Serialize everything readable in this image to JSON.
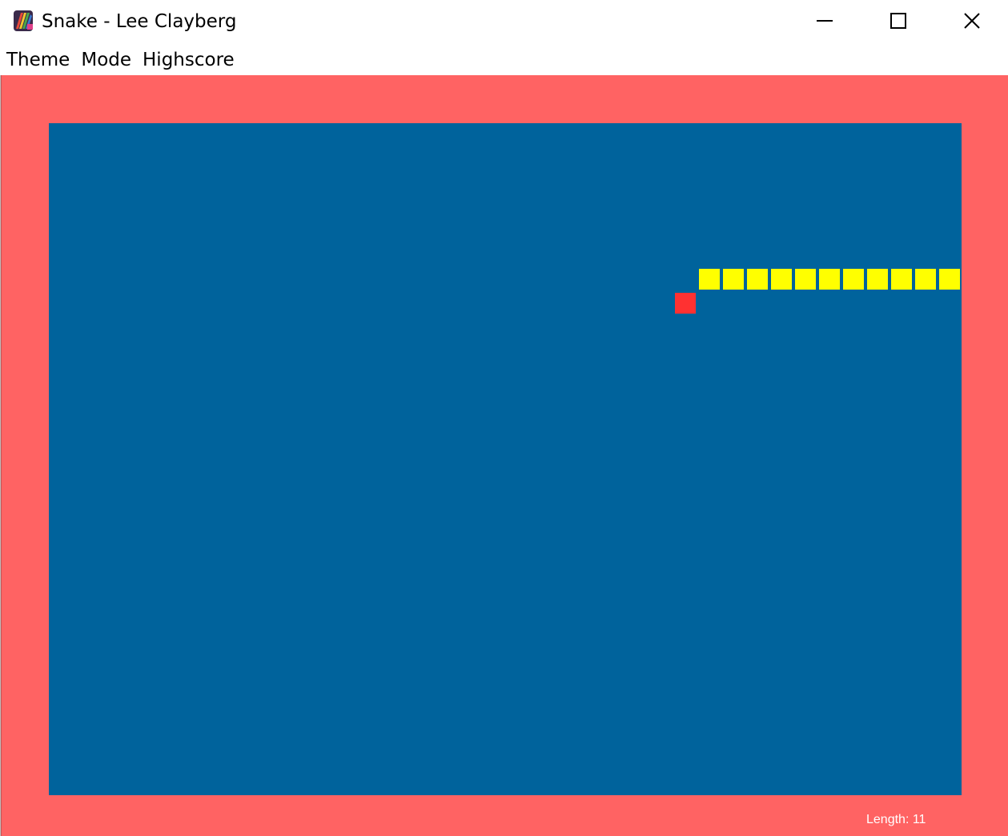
{
  "window": {
    "title": "Snake - Lee Clayberg",
    "icon": "app-icon",
    "controls": {
      "minimize": "minimize-icon",
      "maximize": "maximize-icon",
      "close": "close-icon"
    }
  },
  "menu": {
    "items": [
      {
        "label": "Theme"
      },
      {
        "label": "Mode"
      },
      {
        "label": "Highscore"
      }
    ]
  },
  "game": {
    "colors": {
      "border": "#ff6363",
      "board": "#00639c",
      "snake": "#ffff00",
      "food": "#ff3131"
    },
    "grid": {
      "columns": 38,
      "rows": 28
    },
    "snake": [
      {
        "col": 27,
        "row": 6
      },
      {
        "col": 28,
        "row": 6
      },
      {
        "col": 29,
        "row": 6
      },
      {
        "col": 30,
        "row": 6
      },
      {
        "col": 31,
        "row": 6
      },
      {
        "col": 32,
        "row": 6
      },
      {
        "col": 33,
        "row": 6
      },
      {
        "col": 34,
        "row": 6
      },
      {
        "col": 35,
        "row": 6
      },
      {
        "col": 36,
        "row": 6
      },
      {
        "col": 37,
        "row": 6
      }
    ],
    "food": {
      "col": 26,
      "row": 7
    },
    "length_text": "Length: 11"
  }
}
